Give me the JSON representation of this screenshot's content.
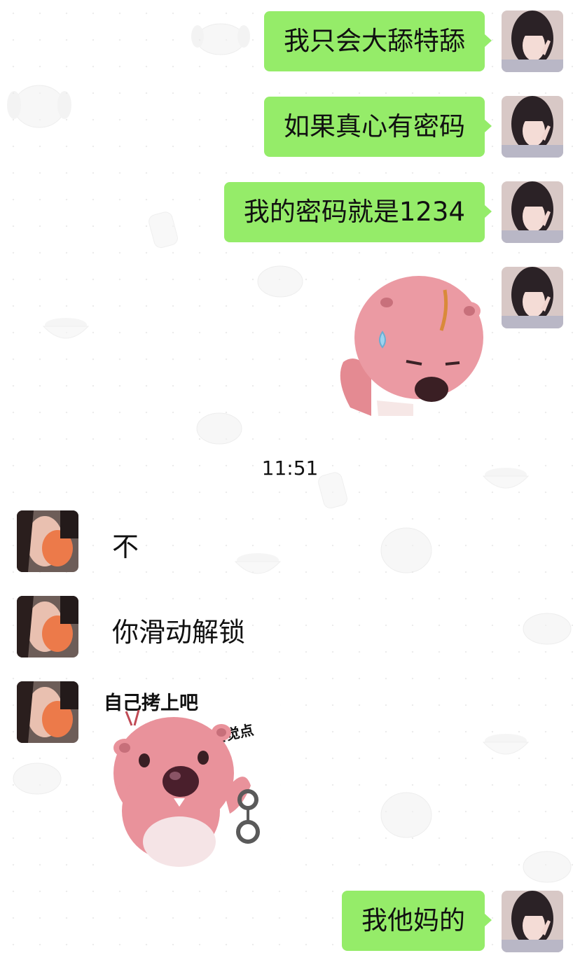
{
  "messages_outgoing": [
    {
      "text": "我只会大舔特舔"
    },
    {
      "text": "如果真心有密码"
    },
    {
      "text": "我的密码就是1234"
    },
    {
      "text": "我他妈的"
    }
  ],
  "timestamp": "11:51",
  "messages_incoming": [
    {
      "text": "不"
    },
    {
      "text": "你滑动解锁"
    }
  ],
  "sticker_incoming": {
    "caption_main": "自己拷上吧",
    "caption_side": "自觉点"
  },
  "colors": {
    "outgoing_bubble": "#95ec69",
    "sticker_pink": "#e88f98"
  },
  "icons": {
    "sticker_outgoing": "pink-beaver-sweat-sticker",
    "sticker_incoming": "pink-beaver-handcuff-sticker"
  }
}
